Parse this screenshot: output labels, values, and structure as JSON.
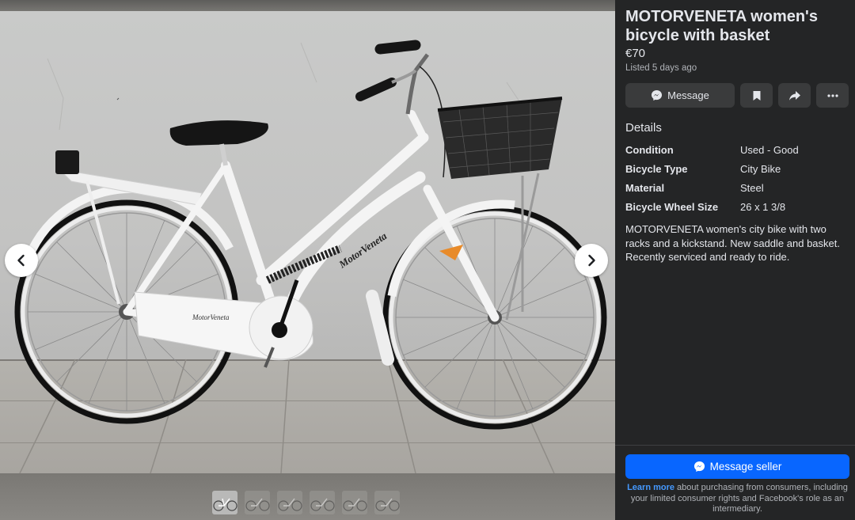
{
  "listing": {
    "title": "MOTORVENETA women's bicycle with basket",
    "price": "€70",
    "listed": "Listed 5 days ago"
  },
  "actions": {
    "message_label": "Message",
    "icons": [
      "messenger-icon",
      "bookmark-icon",
      "share-icon",
      "more-icon"
    ]
  },
  "details": {
    "heading": "Details",
    "rows": [
      {
        "key": "Condition",
        "value": "Used - Good"
      },
      {
        "key": "Bicycle Type",
        "value": "City Bike"
      },
      {
        "key": "Material",
        "value": "Steel"
      },
      {
        "key": "Bicycle Wheel Size",
        "value": "26 x 1 3/8"
      }
    ],
    "description": "MOTORVENETA women's city bike with two racks and a kickstand. New saddle and basket. Recently serviced and ready to ride."
  },
  "footer": {
    "message_seller_label": "Message seller",
    "learn_more": "Learn more",
    "legal_text": " about purchasing from consumers, including your limited consumer rights and Facebook's role as an intermediary."
  },
  "photo": {
    "frame_brand": "MotorVeneta",
    "guard_brand": "MotorVeneta",
    "thumbnail_count": 6,
    "active_thumbnail": 1
  },
  "colors": {
    "panel_bg": "#242526",
    "button_bg": "#3a3b3c",
    "primary_blue": "#0866ff",
    "link_blue": "#4599ff"
  }
}
